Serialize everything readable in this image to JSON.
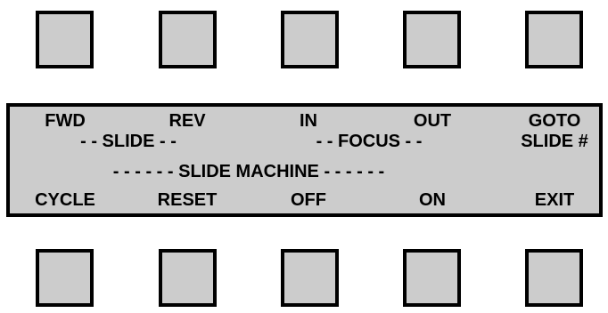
{
  "top_row": {
    "labels": [
      "FWD",
      "REV",
      "IN",
      "OUT",
      "GOTO"
    ]
  },
  "group_labels": {
    "slide": "- - SLIDE - -",
    "focus": "- - FOCUS - -",
    "slide_number": "SLIDE #",
    "machine": "- - - - - - SLIDE MACHINE - - - - - -"
  },
  "bottom_row": {
    "labels": [
      "CYCLE",
      "RESET",
      "OFF",
      "ON",
      "EXIT"
    ]
  },
  "colors": {
    "key_fill": "#cccccc",
    "panel_fill": "#cccccc",
    "border": "#000000",
    "text": "#000000"
  }
}
